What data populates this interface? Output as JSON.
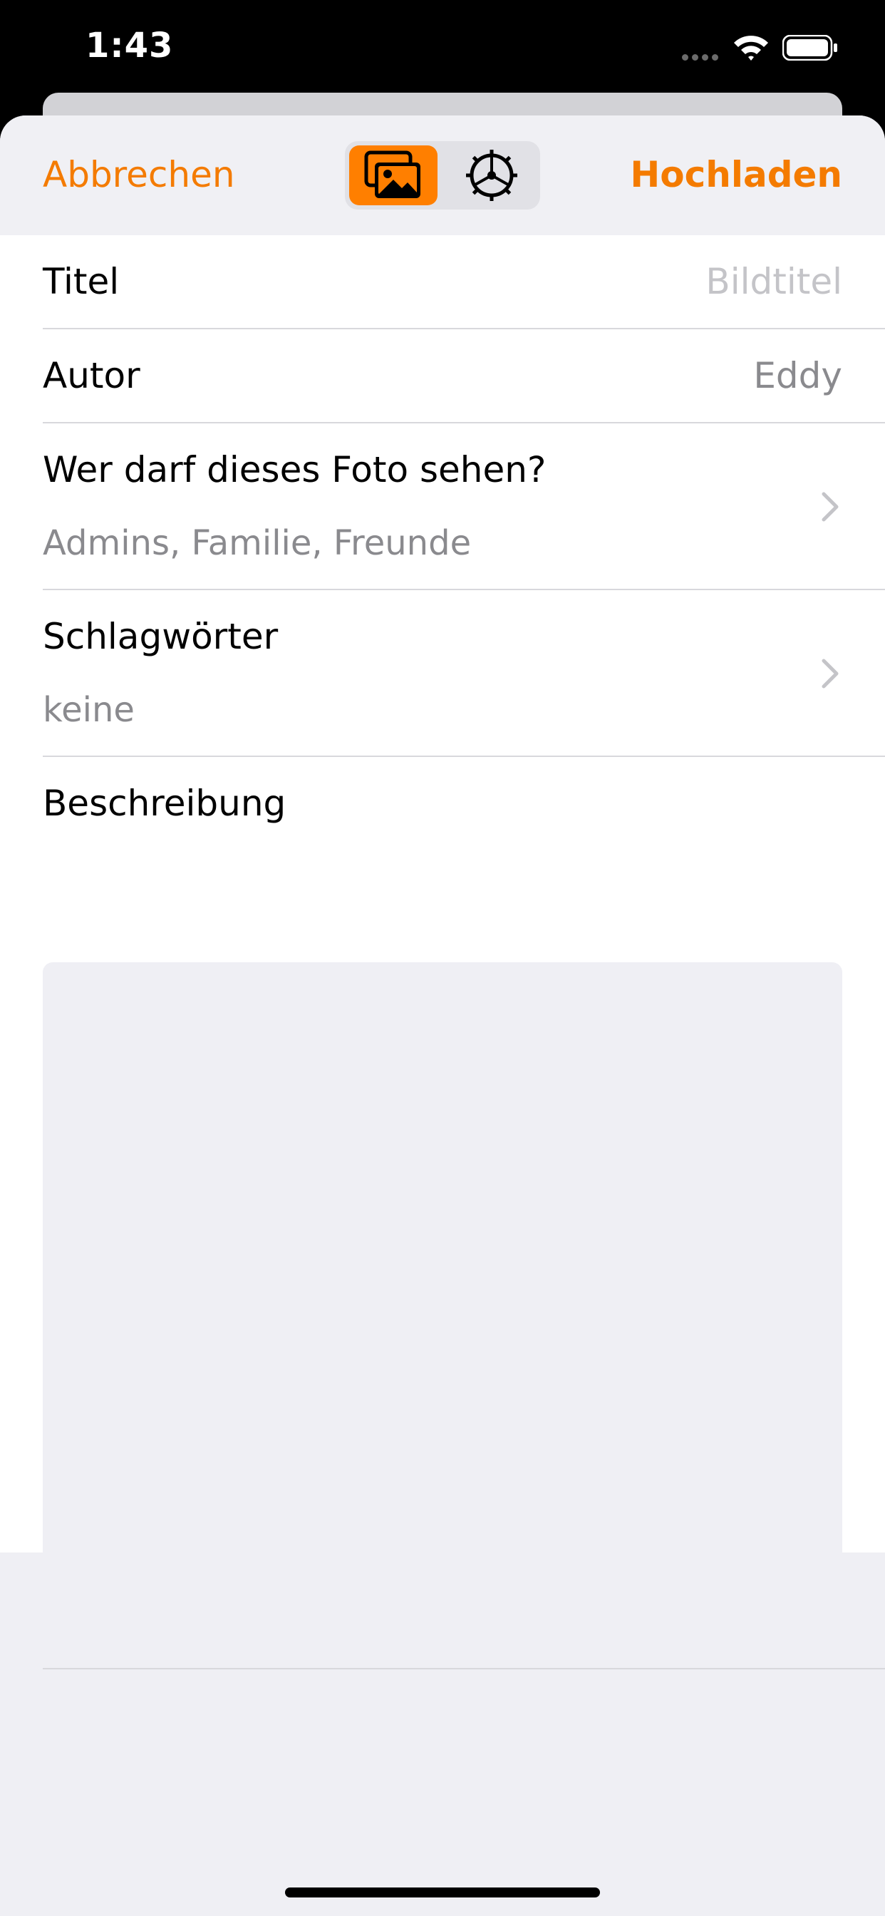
{
  "status_bar": {
    "time": "1:43"
  },
  "nav": {
    "cancel_label": "Abbrechen",
    "upload_label": "Hochladen",
    "segments": [
      {
        "icon": "photos-icon",
        "selected": true
      },
      {
        "icon": "gear-icon",
        "selected": false
      }
    ]
  },
  "form": {
    "title": {
      "label": "Titel",
      "placeholder": "Bildtitel"
    },
    "author": {
      "label": "Autor",
      "value": "Eddy"
    },
    "privacy": {
      "label": "Wer darf dieses Foto sehen?",
      "value": "Admins, Familie, Freunde"
    },
    "tags": {
      "label": "Schlagwörter",
      "value": "keine"
    },
    "description": {
      "label": "Beschreibung",
      "value": ""
    }
  },
  "colors": {
    "accent": "#FF7F00",
    "background": "#EFEFF4"
  }
}
